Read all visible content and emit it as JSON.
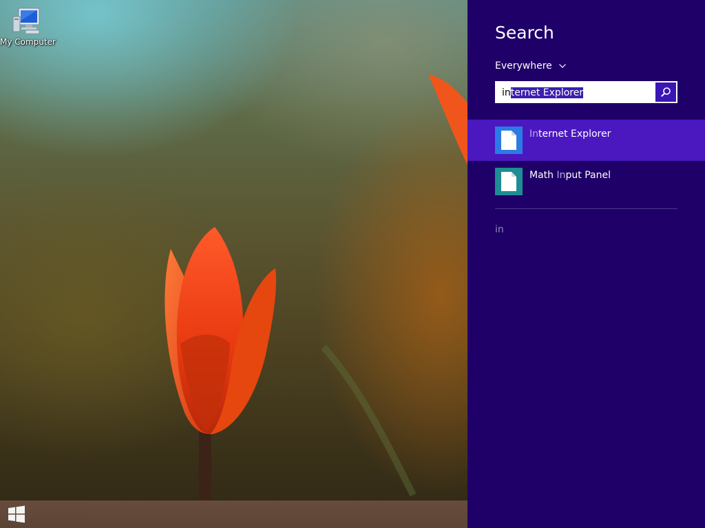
{
  "desktop": {
    "icons": [
      {
        "label": "My Computer",
        "icon": "computer-icon"
      }
    ]
  },
  "taskbar": {
    "start_icon": "windows-logo-icon"
  },
  "search_charm": {
    "title": "Search",
    "scope": "Everywhere",
    "scope_icon": "chevron-down-icon",
    "query_typed": "in",
    "query_autocomplete": "ternet Explorer",
    "search_button_icon": "search-icon",
    "results": [
      {
        "match": "In",
        "rest": "ternet Explorer",
        "icon": "document-icon",
        "tile_color": "#2b7be6",
        "selected": true
      },
      {
        "prefix": "Math ",
        "match": "In",
        "rest": "put Panel",
        "icon": "document-icon",
        "tile_color": "#1e8d94",
        "selected": false
      }
    ],
    "suggestion": "in"
  },
  "colors": {
    "charm_background": "#1f0068",
    "selected_result": "#4a18be",
    "search_button": "#3b16b5",
    "taskbar": "#6a4e3f"
  }
}
